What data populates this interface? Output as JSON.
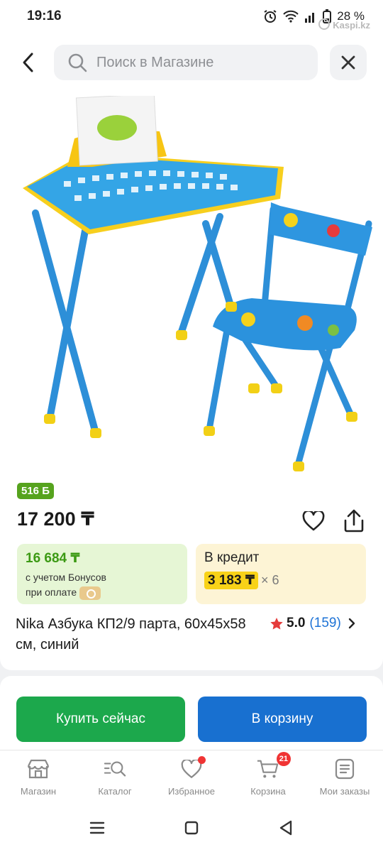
{
  "status": {
    "time": "19:16",
    "battery": "28 %",
    "watermark": "Kaspi.kz"
  },
  "search": {
    "placeholder": "Поиск в Магазине"
  },
  "product": {
    "bonus_badge": "516 Б",
    "price": "17 200 ₸",
    "bonus_price": "16 684 ₸",
    "bonus_line1": "с учетом Бонусов",
    "bonus_line2": "при оплате",
    "credit_label": "В кредит",
    "credit_amount": "3 183 ₸",
    "credit_multiplier": "× 6",
    "title": "Nika Азбука КП2/9 парта, 60x45x58 см, синий",
    "rating": "5.0",
    "reviews": "(159)"
  },
  "actions": {
    "buy_label": "Купить сейчас",
    "cart_label": "В корзину"
  },
  "bottom_nav": {
    "items": [
      {
        "label": "Магазин",
        "icon": "shop-icon"
      },
      {
        "label": "Каталог",
        "icon": "catalog-search-icon"
      },
      {
        "label": "Избранное",
        "icon": "heart-icon"
      },
      {
        "label": "Корзина",
        "icon": "cart-icon",
        "badge": "21"
      },
      {
        "label": "Мои заказы",
        "icon": "orders-icon"
      }
    ]
  },
  "colors": {
    "green": "#1ca84c",
    "blue": "#1870d0",
    "badge_red": "#f03434",
    "credit_yellow": "#f8d218"
  }
}
